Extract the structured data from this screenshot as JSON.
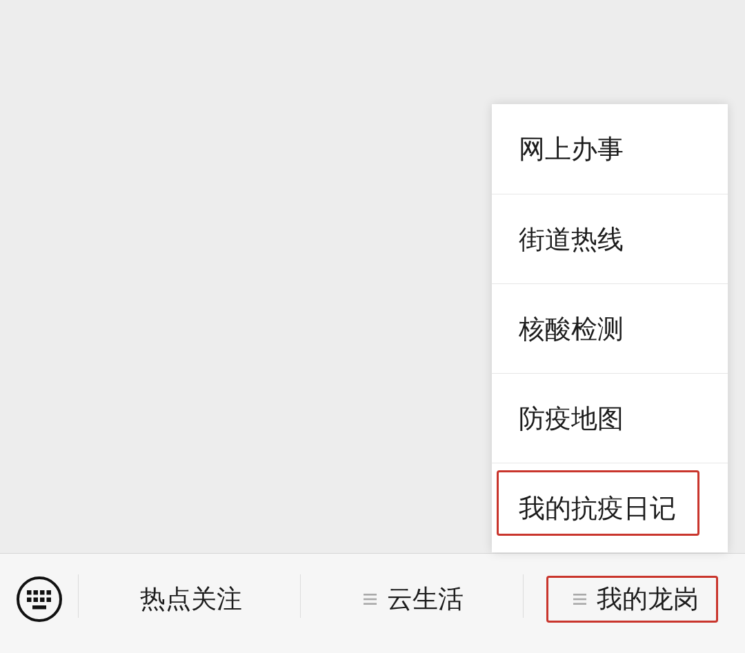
{
  "bottom_bar": {
    "tabs": [
      {
        "label": "热点关注",
        "kind": "link",
        "highlighted": false
      },
      {
        "label": "云生活",
        "kind": "menu",
        "highlighted": false
      },
      {
        "label": "我的龙岗",
        "kind": "menu",
        "highlighted": true,
        "items": [
          {
            "label": "网上办事",
            "highlighted": false
          },
          {
            "label": "街道热线",
            "highlighted": false
          },
          {
            "label": "核酸检测",
            "highlighted": false
          },
          {
            "label": "防疫地图",
            "highlighted": false
          },
          {
            "label": "我的抗疫日记",
            "highlighted": true
          }
        ]
      }
    ]
  }
}
